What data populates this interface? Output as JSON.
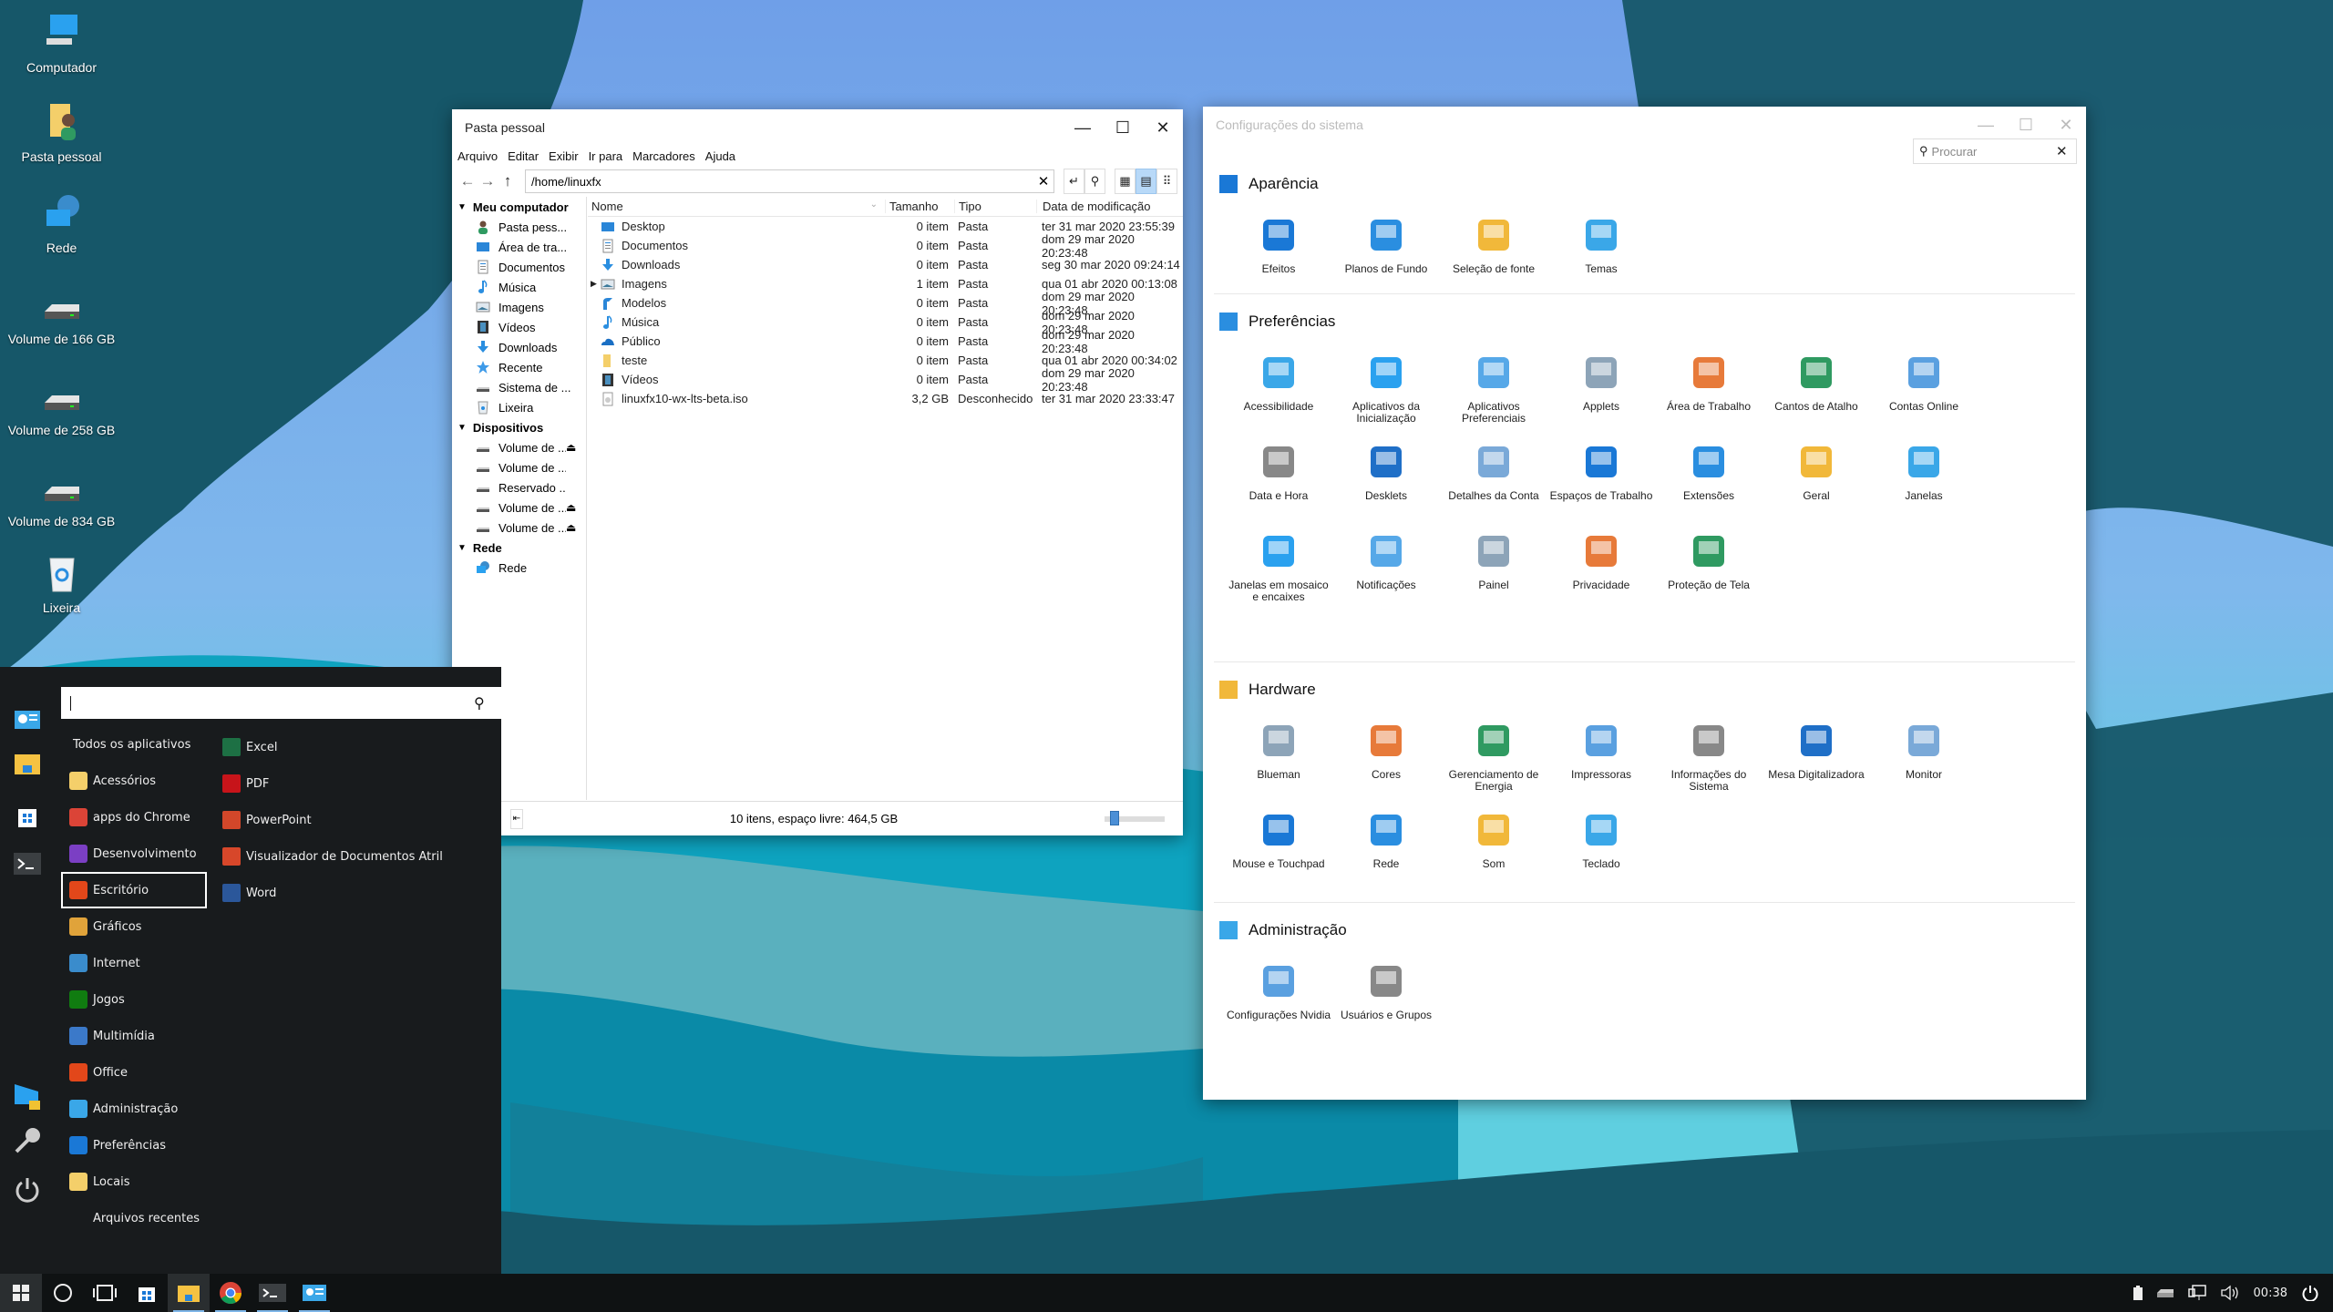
{
  "desktop": {
    "icons": [
      {
        "label": "Computador",
        "icon": "computer-icon"
      },
      {
        "label": "Pasta pessoal",
        "icon": "home-folder-icon"
      },
      {
        "label": "Rede",
        "icon": "network-icon"
      },
      {
        "label": "Volume de 166 GB",
        "icon": "drive-icon"
      },
      {
        "label": "Volume de 258 GB",
        "icon": "drive-icon"
      },
      {
        "label": "Volume de 834 GB",
        "icon": "drive-icon"
      },
      {
        "label": "Lixeira",
        "icon": "trash-icon"
      }
    ]
  },
  "file_manager": {
    "title": "Pasta pessoal",
    "menu": [
      "Arquivo",
      "Editar",
      "Exibir",
      "Ir para",
      "Marcadores",
      "Ajuda"
    ],
    "path": "/home/linuxfx",
    "sidebar": {
      "groups": [
        {
          "label": "Meu computador",
          "items": [
            {
              "label": "Pasta pess...",
              "icon": "user-icon"
            },
            {
              "label": "Área de tra...",
              "icon": "desktop-icon"
            },
            {
              "label": "Documentos",
              "icon": "document-icon"
            },
            {
              "label": "Música",
              "icon": "music-icon"
            },
            {
              "label": "Imagens",
              "icon": "image-icon"
            },
            {
              "label": "Vídeos",
              "icon": "video-icon"
            },
            {
              "label": "Downloads",
              "icon": "download-icon"
            },
            {
              "label": "Recente",
              "icon": "star-icon"
            },
            {
              "label": "Sistema de ...",
              "icon": "drive-icon"
            },
            {
              "label": "Lixeira",
              "icon": "trash-icon"
            }
          ]
        },
        {
          "label": "Dispositivos",
          "items": [
            {
              "label": "Volume de ...",
              "icon": "drive-icon",
              "eject": true
            },
            {
              "label": "Volume de ...",
              "icon": "drive-icon",
              "eject": false
            },
            {
              "label": "Reservado ...",
              "icon": "drive-icon",
              "eject": false
            },
            {
              "label": "Volume de ...",
              "icon": "drive-icon",
              "eject": true
            },
            {
              "label": "Volume de ...",
              "icon": "drive-icon",
              "eject": true
            }
          ]
        },
        {
          "label": "Rede",
          "items": [
            {
              "label": "Rede",
              "icon": "network-icon"
            }
          ]
        }
      ]
    },
    "columns": [
      "Nome",
      "Tamanho",
      "Tipo",
      "Data de modificação"
    ],
    "files": [
      {
        "name": "Desktop",
        "size": "0 item",
        "type": "Pasta",
        "date": "ter 31 mar 2020 23:55:39",
        "icon": "desktop-icon"
      },
      {
        "name": "Documentos",
        "size": "0 item",
        "type": "Pasta",
        "date": "dom 29 mar 2020 20:23:48",
        "icon": "document-icon"
      },
      {
        "name": "Downloads",
        "size": "0 item",
        "type": "Pasta",
        "date": "seg 30 mar 2020 09:24:14",
        "icon": "download-icon"
      },
      {
        "name": "Imagens",
        "size": "1 item",
        "type": "Pasta",
        "date": "qua 01 abr 2020 00:13:08",
        "icon": "image-icon",
        "expandable": true
      },
      {
        "name": "Modelos",
        "size": "0 item",
        "type": "Pasta",
        "date": "dom 29 mar 2020 20:23:48",
        "icon": "template-icon"
      },
      {
        "name": "Música",
        "size": "0 item",
        "type": "Pasta",
        "date": "dom 29 mar 2020 20:23:48",
        "icon": "music-icon"
      },
      {
        "name": "Público",
        "size": "0 item",
        "type": "Pasta",
        "date": "dom 29 mar 2020 20:23:48",
        "icon": "cloud-icon"
      },
      {
        "name": "teste",
        "size": "0 item",
        "type": "Pasta",
        "date": "qua 01 abr 2020 00:34:02",
        "icon": "folder-icon"
      },
      {
        "name": "Vídeos",
        "size": "0 item",
        "type": "Pasta",
        "date": "dom 29 mar 2020 20:23:48",
        "icon": "video-icon"
      },
      {
        "name": "linuxfx10-wx-lts-beta.iso",
        "size": "3,2 GB",
        "type": "Desconhecido",
        "date": "ter 31 mar 2020 23:33:47",
        "icon": "disc-file-icon"
      }
    ],
    "status": "10 itens, espaço livre: 464,5 GB",
    "zoom_level": 0.1
  },
  "settings": {
    "title": "Configurações do sistema",
    "search_placeholder": "Procurar",
    "sections": [
      {
        "title": "Aparência",
        "items": [
          "Efeitos",
          "Planos de Fundo",
          "Seleção de fonte",
          "Temas"
        ]
      },
      {
        "title": "Preferências",
        "items": [
          "Acessibilidade",
          "Aplicativos da Inicialização",
          "Aplicativos Preferenciais",
          "Applets",
          "Área de Trabalho",
          "Cantos de Atalho",
          "Contas Online",
          "Data e Hora",
          "Desklets",
          "Detalhes da Conta",
          "Espaços de Trabalho",
          "Extensões",
          "Geral",
          "Janelas",
          "Janelas em mosaico e encaixes",
          "Notificações",
          "Painel",
          "Privacidade",
          "Proteção de Tela"
        ]
      },
      {
        "title": "Hardware",
        "items": [
          "Blueman",
          "Cores",
          "Gerenciamento de Energia",
          "Impressoras",
          "Informações do Sistema",
          "Mesa Digitalizadora",
          "Monitor",
          "Mouse e Touchpad",
          "Rede",
          "Som",
          "Teclado"
        ]
      },
      {
        "title": "Administração",
        "items": [
          "Configurações Nvidia",
          "Usuários e Grupos"
        ]
      }
    ]
  },
  "start_menu": {
    "search_value": "",
    "all_apps_label": "Todos os aplicativos",
    "categories": [
      "Acessórios",
      "apps do Chrome",
      "Desenvolvimento",
      "Escritório",
      "Gráficos",
      "Internet",
      "Jogos",
      "Multimídia",
      "Office",
      "Administração",
      "Preferências",
      "Locais",
      "Arquivos recentes"
    ],
    "selected_category": "Escritório",
    "apps": [
      "Excel",
      "PDF",
      "PowerPoint",
      "Visualizador de Documentos Atril",
      "Word"
    ]
  },
  "taskbar": {
    "items": [
      "start-button",
      "search-button",
      "task-view-button",
      "store",
      "file-manager",
      "chrome",
      "terminal",
      "system-settings"
    ],
    "clock": "00:38"
  },
  "colors": {
    "accent": "#4b8fd6",
    "desktop_bg": "#165769",
    "sky": "#75a5ea"
  }
}
